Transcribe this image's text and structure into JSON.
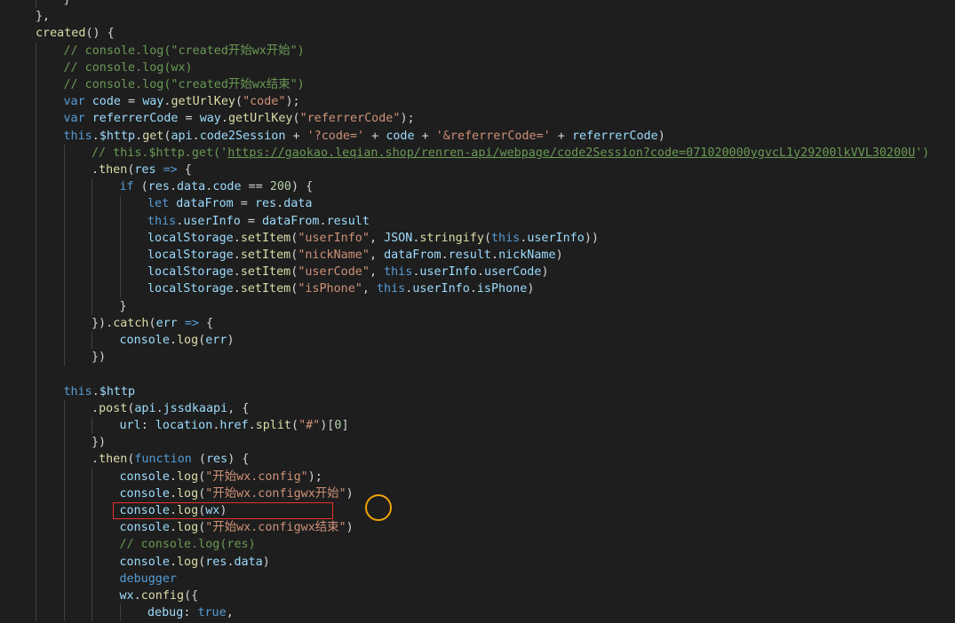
{
  "editor": {
    "language": "javascript",
    "theme_colors": {
      "background": "#1e1e1e",
      "keyword": "#569cd6",
      "string": "#ce9178",
      "comment": "#6a9955",
      "function": "#dcdcaa",
      "variable": "#9cdcfe",
      "number": "#b5cea8",
      "highlight_box": "#e5332a",
      "cursor_ring": "#f0a30a"
    },
    "lines": [
      {
        "indent": 2,
        "tokens": [
          [
            "plain",
            "}"
          ]
        ]
      },
      {
        "indent": 1,
        "tokens": [
          [
            "plain",
            "},"
          ]
        ]
      },
      {
        "indent": 1,
        "tokens": [
          [
            "fn",
            "created"
          ],
          [
            "plain",
            "() {"
          ]
        ]
      },
      {
        "indent": 2,
        "tokens": [
          [
            "cmt",
            "// console.log(\"created开始wx开始\")"
          ]
        ]
      },
      {
        "indent": 2,
        "tokens": [
          [
            "cmt",
            "// console.log(wx)"
          ]
        ]
      },
      {
        "indent": 2,
        "tokens": [
          [
            "cmt",
            "// console.log(\"created开始wx结束\")"
          ]
        ]
      },
      {
        "indent": 2,
        "tokens": [
          [
            "kw",
            "var "
          ],
          [
            "var",
            "code"
          ],
          [
            "plain",
            " = "
          ],
          [
            "var",
            "way"
          ],
          [
            "plain",
            "."
          ],
          [
            "fn",
            "getUrlKey"
          ],
          [
            "plain",
            "("
          ],
          [
            "str",
            "\"code\""
          ],
          [
            "plain",
            ");"
          ]
        ]
      },
      {
        "indent": 2,
        "tokens": [
          [
            "kw",
            "var "
          ],
          [
            "var",
            "referrerCode"
          ],
          [
            "plain",
            " = "
          ],
          [
            "var",
            "way"
          ],
          [
            "plain",
            "."
          ],
          [
            "fn",
            "getUrlKey"
          ],
          [
            "plain",
            "("
          ],
          [
            "str",
            "\"referrerCode\""
          ],
          [
            "plain",
            ");"
          ]
        ]
      },
      {
        "indent": 2,
        "tokens": [
          [
            "kw",
            "this"
          ],
          [
            "plain",
            "."
          ],
          [
            "var",
            "$http"
          ],
          [
            "plain",
            "."
          ],
          [
            "fn",
            "get"
          ],
          [
            "plain",
            "("
          ],
          [
            "var",
            "api"
          ],
          [
            "plain",
            "."
          ],
          [
            "var",
            "code2Session"
          ],
          [
            "plain",
            " + "
          ],
          [
            "str",
            "'?code='"
          ],
          [
            "plain",
            " + "
          ],
          [
            "var",
            "code"
          ],
          [
            "plain",
            " + "
          ],
          [
            "str",
            "'&referrerCode='"
          ],
          [
            "plain",
            " + "
          ],
          [
            "var",
            "referrerCode"
          ],
          [
            "plain",
            ")"
          ]
        ]
      },
      {
        "indent": 3,
        "tokens": [
          [
            "cmt",
            "// this.$http.get('"
          ],
          [
            "link",
            "https://gaokao.leqian.shop/renren-api/webpage/code2Session?code=071020000ygvcL1y29200lkVVL30200U"
          ],
          [
            "cmt",
            "')"
          ]
        ]
      },
      {
        "indent": 3,
        "tokens": [
          [
            "plain",
            "."
          ],
          [
            "fn",
            "then"
          ],
          [
            "plain",
            "("
          ],
          [
            "var",
            "res"
          ],
          [
            "plain",
            " "
          ],
          [
            "kw",
            "=>"
          ],
          [
            "plain",
            " {"
          ]
        ]
      },
      {
        "indent": 4,
        "tokens": [
          [
            "kw",
            "if"
          ],
          [
            "plain",
            " ("
          ],
          [
            "var",
            "res"
          ],
          [
            "plain",
            "."
          ],
          [
            "var",
            "data"
          ],
          [
            "plain",
            "."
          ],
          [
            "var",
            "code"
          ],
          [
            "plain",
            " == "
          ],
          [
            "num",
            "200"
          ],
          [
            "plain",
            ") {"
          ]
        ]
      },
      {
        "indent": 5,
        "tokens": [
          [
            "kw",
            "let "
          ],
          [
            "var",
            "dataFrom"
          ],
          [
            "plain",
            " = "
          ],
          [
            "var",
            "res"
          ],
          [
            "plain",
            "."
          ],
          [
            "var",
            "data"
          ]
        ]
      },
      {
        "indent": 5,
        "tokens": [
          [
            "kw",
            "this"
          ],
          [
            "plain",
            "."
          ],
          [
            "var",
            "userInfo"
          ],
          [
            "plain",
            " = "
          ],
          [
            "var",
            "dataFrom"
          ],
          [
            "plain",
            "."
          ],
          [
            "var",
            "result"
          ]
        ]
      },
      {
        "indent": 5,
        "tokens": [
          [
            "var",
            "localStorage"
          ],
          [
            "plain",
            "."
          ],
          [
            "fn",
            "setItem"
          ],
          [
            "plain",
            "("
          ],
          [
            "str",
            "\"userInfo\""
          ],
          [
            "plain",
            ", "
          ],
          [
            "var",
            "JSON"
          ],
          [
            "plain",
            "."
          ],
          [
            "fn",
            "stringify"
          ],
          [
            "plain",
            "("
          ],
          [
            "kw",
            "this"
          ],
          [
            "plain",
            "."
          ],
          [
            "var",
            "userInfo"
          ],
          [
            "plain",
            "))"
          ]
        ]
      },
      {
        "indent": 5,
        "tokens": [
          [
            "var",
            "localStorage"
          ],
          [
            "plain",
            "."
          ],
          [
            "fn",
            "setItem"
          ],
          [
            "plain",
            "("
          ],
          [
            "str",
            "\"nickName\""
          ],
          [
            "plain",
            ", "
          ],
          [
            "var",
            "dataFrom"
          ],
          [
            "plain",
            "."
          ],
          [
            "var",
            "result"
          ],
          [
            "plain",
            "."
          ],
          [
            "var",
            "nickName"
          ],
          [
            "plain",
            ")"
          ]
        ]
      },
      {
        "indent": 5,
        "tokens": [
          [
            "var",
            "localStorage"
          ],
          [
            "plain",
            "."
          ],
          [
            "fn",
            "setItem"
          ],
          [
            "plain",
            "("
          ],
          [
            "str",
            "\"userCode\""
          ],
          [
            "plain",
            ", "
          ],
          [
            "kw",
            "this"
          ],
          [
            "plain",
            "."
          ],
          [
            "var",
            "userInfo"
          ],
          [
            "plain",
            "."
          ],
          [
            "var",
            "userCode"
          ],
          [
            "plain",
            ")"
          ]
        ]
      },
      {
        "indent": 5,
        "tokens": [
          [
            "var",
            "localStorage"
          ],
          [
            "plain",
            "."
          ],
          [
            "fn",
            "setItem"
          ],
          [
            "plain",
            "("
          ],
          [
            "str",
            "\"isPhone\""
          ],
          [
            "plain",
            ", "
          ],
          [
            "kw",
            "this"
          ],
          [
            "plain",
            "."
          ],
          [
            "var",
            "userInfo"
          ],
          [
            "plain",
            "."
          ],
          [
            "var",
            "isPhone"
          ],
          [
            "plain",
            ")"
          ]
        ]
      },
      {
        "indent": 4,
        "tokens": [
          [
            "plain",
            "}"
          ]
        ]
      },
      {
        "indent": 3,
        "tokens": [
          [
            "plain",
            "})."
          ],
          [
            "fn",
            "catch"
          ],
          [
            "plain",
            "("
          ],
          [
            "var",
            "err"
          ],
          [
            "plain",
            " "
          ],
          [
            "kw",
            "=>"
          ],
          [
            "plain",
            " {"
          ]
        ]
      },
      {
        "indent": 4,
        "tokens": [
          [
            "var",
            "console"
          ],
          [
            "plain",
            "."
          ],
          [
            "fn",
            "log"
          ],
          [
            "plain",
            "("
          ],
          [
            "var",
            "err"
          ],
          [
            "plain",
            ")"
          ]
        ]
      },
      {
        "indent": 3,
        "tokens": [
          [
            "plain",
            "})"
          ]
        ]
      },
      {
        "indent": 2,
        "tokens": []
      },
      {
        "indent": 2,
        "tokens": [
          [
            "kw",
            "this"
          ],
          [
            "plain",
            "."
          ],
          [
            "var",
            "$http"
          ]
        ]
      },
      {
        "indent": 3,
        "tokens": [
          [
            "plain",
            "."
          ],
          [
            "fn",
            "post"
          ],
          [
            "plain",
            "("
          ],
          [
            "var",
            "api"
          ],
          [
            "plain",
            "."
          ],
          [
            "var",
            "jssdkaapi"
          ],
          [
            "plain",
            ", {"
          ]
        ]
      },
      {
        "indent": 4,
        "tokens": [
          [
            "var",
            "url"
          ],
          [
            "plain",
            ": "
          ],
          [
            "var",
            "location"
          ],
          [
            "plain",
            "."
          ],
          [
            "var",
            "href"
          ],
          [
            "plain",
            "."
          ],
          [
            "fn",
            "split"
          ],
          [
            "plain",
            "("
          ],
          [
            "str",
            "\"#\""
          ],
          [
            "plain",
            ")["
          ],
          [
            "num",
            "0"
          ],
          [
            "plain",
            "]"
          ]
        ]
      },
      {
        "indent": 3,
        "tokens": [
          [
            "plain",
            "})"
          ]
        ]
      },
      {
        "indent": 3,
        "tokens": [
          [
            "plain",
            "."
          ],
          [
            "fn",
            "then"
          ],
          [
            "plain",
            "("
          ],
          [
            "kw",
            "function"
          ],
          [
            "plain",
            " ("
          ],
          [
            "var",
            "res"
          ],
          [
            "plain",
            ") {"
          ]
        ]
      },
      {
        "indent": 4,
        "tokens": [
          [
            "var",
            "console"
          ],
          [
            "plain",
            "."
          ],
          [
            "fn",
            "log"
          ],
          [
            "plain",
            "("
          ],
          [
            "str",
            "\"开始wx.config\""
          ],
          [
            "plain",
            ");"
          ]
        ]
      },
      {
        "indent": 4,
        "tokens": [
          [
            "var",
            "console"
          ],
          [
            "plain",
            "."
          ],
          [
            "fn",
            "log"
          ],
          [
            "plain",
            "("
          ],
          [
            "str",
            "\"开始wx.configwx开始\""
          ],
          [
            "plain",
            ")"
          ]
        ]
      },
      {
        "indent": 4,
        "tokens": [
          [
            "var",
            "console"
          ],
          [
            "plain",
            "."
          ],
          [
            "fn",
            "log"
          ],
          [
            "plain",
            "("
          ],
          [
            "var",
            "wx"
          ],
          [
            "plain",
            ")"
          ]
        ]
      },
      {
        "indent": 4,
        "tokens": [
          [
            "var",
            "console"
          ],
          [
            "plain",
            "."
          ],
          [
            "fn",
            "log"
          ],
          [
            "plain",
            "("
          ],
          [
            "str",
            "\"开始wx.configwx结束\""
          ],
          [
            "plain",
            ")"
          ]
        ]
      },
      {
        "indent": 4,
        "tokens": [
          [
            "cmt",
            "// console.log(res)"
          ]
        ]
      },
      {
        "indent": 4,
        "tokens": [
          [
            "var",
            "console"
          ],
          [
            "plain",
            "."
          ],
          [
            "fn",
            "log"
          ],
          [
            "plain",
            "("
          ],
          [
            "var",
            "res"
          ],
          [
            "plain",
            "."
          ],
          [
            "var",
            "data"
          ],
          [
            "plain",
            ")"
          ]
        ]
      },
      {
        "indent": 4,
        "tokens": [
          [
            "kw",
            "debugger"
          ]
        ]
      },
      {
        "indent": 4,
        "tokens": [
          [
            "var",
            "wx"
          ],
          [
            "plain",
            "."
          ],
          [
            "fn",
            "config"
          ],
          [
            "plain",
            "({"
          ]
        ]
      },
      {
        "indent": 5,
        "tokens": [
          [
            "var",
            "debug"
          ],
          [
            "plain",
            ": "
          ],
          [
            "kw",
            "true"
          ],
          [
            "plain",
            ","
          ]
        ]
      }
    ]
  }
}
